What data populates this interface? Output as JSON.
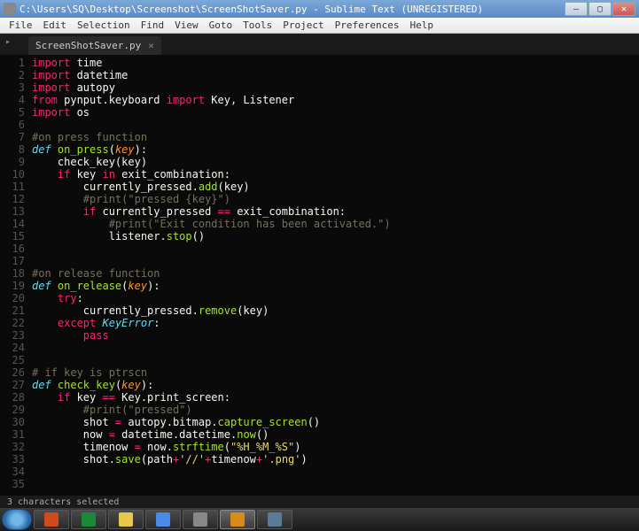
{
  "title": "C:\\Users\\SQ\\Desktop\\Screenshot\\ScreenShotSaver.py - Sublime Text (UNREGISTERED)",
  "menu": [
    "File",
    "Edit",
    "Selection",
    "Find",
    "View",
    "Goto",
    "Tools",
    "Project",
    "Preferences",
    "Help"
  ],
  "tab": {
    "label": "ScreenShotSaver.py",
    "close": "×"
  },
  "tabfold": "▸",
  "win": {
    "min": "—",
    "max": "▢",
    "close": "✕"
  },
  "lines": [
    {
      "n": 1,
      "seg": [
        [
          "k",
          "import "
        ],
        [
          "w",
          "time"
        ]
      ]
    },
    {
      "n": 2,
      "seg": [
        [
          "k",
          "import "
        ],
        [
          "w",
          "datetime"
        ]
      ]
    },
    {
      "n": 3,
      "seg": [
        [
          "k",
          "import "
        ],
        [
          "w",
          "autopy"
        ]
      ]
    },
    {
      "n": 4,
      "seg": [
        [
          "k",
          "from "
        ],
        [
          "w",
          "pynput.keyboard "
        ],
        [
          "k",
          "import "
        ],
        [
          "w",
          "Key, Listener"
        ]
      ]
    },
    {
      "n": 5,
      "seg": [
        [
          "k",
          "import "
        ],
        [
          "w",
          "os"
        ]
      ]
    },
    {
      "n": 6,
      "seg": []
    },
    {
      "n": 7,
      "seg": [
        [
          "c",
          "#on press function"
        ]
      ]
    },
    {
      "n": 8,
      "seg": [
        [
          "d",
          "def "
        ],
        [
          "f",
          "on_press"
        ],
        [
          "w",
          "("
        ],
        [
          "p",
          "key"
        ],
        [
          "w",
          "):"
        ]
      ]
    },
    {
      "n": 9,
      "seg": [
        [
          "w",
          "    check_key(key)"
        ]
      ]
    },
    {
      "n": 10,
      "seg": [
        [
          "w",
          "    "
        ],
        [
          "k",
          "if"
        ],
        [
          "w",
          " key "
        ],
        [
          "k",
          "in"
        ],
        [
          "w",
          " exit_combination:"
        ]
      ]
    },
    {
      "n": 11,
      "seg": [
        [
          "w",
          "        currently_pressed."
        ],
        [
          "f",
          "add"
        ],
        [
          "w",
          "(key)"
        ]
      ]
    },
    {
      "n": 12,
      "seg": [
        [
          "w",
          "        "
        ],
        [
          "c",
          "#print(\"pressed {key}\")"
        ]
      ]
    },
    {
      "n": 13,
      "seg": [
        [
          "w",
          "        "
        ],
        [
          "k",
          "if"
        ],
        [
          "w",
          " currently_pressed "
        ],
        [
          "o",
          "=="
        ],
        [
          "w",
          " exit_combination:"
        ]
      ]
    },
    {
      "n": 14,
      "seg": [
        [
          "w",
          "            "
        ],
        [
          "c",
          "#print(\"Exit condition has been activated.\")"
        ]
      ]
    },
    {
      "n": 15,
      "seg": [
        [
          "w",
          "            listener."
        ],
        [
          "f",
          "stop"
        ],
        [
          "w",
          "()"
        ]
      ]
    },
    {
      "n": 16,
      "seg": []
    },
    {
      "n": 17,
      "seg": []
    },
    {
      "n": 18,
      "seg": [
        [
          "c",
          "#on release function"
        ]
      ]
    },
    {
      "n": 19,
      "seg": [
        [
          "d",
          "def "
        ],
        [
          "f",
          "on_release"
        ],
        [
          "w",
          "("
        ],
        [
          "p",
          "key"
        ],
        [
          "w",
          "):"
        ]
      ]
    },
    {
      "n": 20,
      "seg": [
        [
          "w",
          "    "
        ],
        [
          "k",
          "try"
        ],
        [
          "w",
          ":"
        ]
      ]
    },
    {
      "n": 21,
      "seg": [
        [
          "w",
          "        currently_pressed."
        ],
        [
          "f",
          "remove"
        ],
        [
          "w",
          "(key)"
        ]
      ]
    },
    {
      "n": 22,
      "seg": [
        [
          "w",
          "    "
        ],
        [
          "k",
          "except"
        ],
        [
          "w",
          " "
        ],
        [
          "d",
          "KeyError"
        ],
        [
          "w",
          ":"
        ]
      ]
    },
    {
      "n": 23,
      "seg": [
        [
          "w",
          "        "
        ],
        [
          "k",
          "pass"
        ]
      ]
    },
    {
      "n": 24,
      "seg": []
    },
    {
      "n": 25,
      "seg": []
    },
    {
      "n": 26,
      "seg": [
        [
          "c",
          "# if key is ptrscn"
        ]
      ]
    },
    {
      "n": 27,
      "seg": [
        [
          "d",
          "def "
        ],
        [
          "f",
          "check_key"
        ],
        [
          "w",
          "("
        ],
        [
          "p",
          "key"
        ],
        [
          "w",
          "):"
        ]
      ]
    },
    {
      "n": 28,
      "seg": [
        [
          "w",
          "    "
        ],
        [
          "k",
          "if"
        ],
        [
          "w",
          " key "
        ],
        [
          "o",
          "=="
        ],
        [
          "w",
          " Key.print_screen:"
        ]
      ]
    },
    {
      "n": 29,
      "seg": [
        [
          "w",
          "        "
        ],
        [
          "c",
          "#print(\"pressed\")"
        ]
      ]
    },
    {
      "n": 30,
      "seg": [
        [
          "w",
          "        shot "
        ],
        [
          "o",
          "="
        ],
        [
          "w",
          " autopy.bitmap."
        ],
        [
          "f",
          "capture_screen"
        ],
        [
          "w",
          "()"
        ]
      ]
    },
    {
      "n": 31,
      "seg": [
        [
          "w",
          "        now "
        ],
        [
          "o",
          "="
        ],
        [
          "w",
          " datetime.datetime."
        ],
        [
          "f",
          "now"
        ],
        [
          "w",
          "()"
        ]
      ]
    },
    {
      "n": 32,
      "seg": [
        [
          "w",
          "        timenow "
        ],
        [
          "o",
          "="
        ],
        [
          "w",
          " now."
        ],
        [
          "f",
          "strftime"
        ],
        [
          "w",
          "("
        ],
        [
          "s",
          "\"%H_%M_%S\""
        ],
        [
          "w",
          ")"
        ]
      ]
    },
    {
      "n": 33,
      "seg": [
        [
          "w",
          "        shot."
        ],
        [
          "f",
          "save"
        ],
        [
          "w",
          "(path"
        ],
        [
          "o",
          "+"
        ],
        [
          "s",
          "'//'"
        ],
        [
          "o",
          "+"
        ],
        [
          "w",
          "timenow"
        ],
        [
          "o",
          "+"
        ],
        [
          "s",
          "'.png'"
        ],
        [
          "w",
          ")"
        ]
      ]
    },
    {
      "n": 34,
      "seg": []
    },
    {
      "n": 35,
      "seg": []
    }
  ],
  "status": "3 characters selected",
  "taskbar_icons": [
    "powerpoint",
    "excel",
    "explorer",
    "chrome",
    "double-arrow",
    "sublime",
    "app"
  ]
}
